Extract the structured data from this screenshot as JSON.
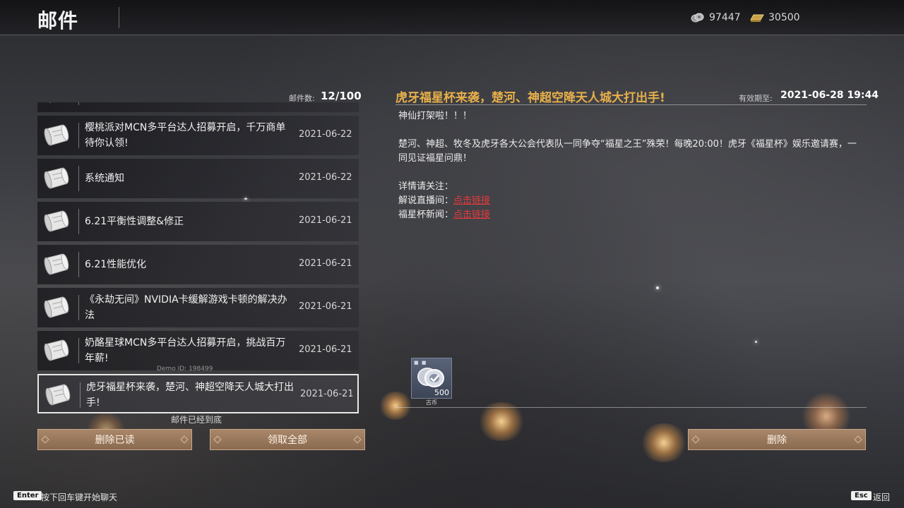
{
  "header": {
    "title": "邮件",
    "currency": [
      {
        "icon": "silver-coin-icon",
        "value": "97447"
      },
      {
        "icon": "gold-ingot-icon",
        "value": "30500"
      }
    ]
  },
  "mail_list": {
    "count_label": "邮件数:",
    "count_value": "12/100",
    "items": [
      {
        "title": "赛  寺日豆场",
        "date": ""
      },
      {
        "title": "樱桃派对MCN多平台达人招募开启，千万商单待你认领!",
        "date": "2021-06-22"
      },
      {
        "title": "系统通知",
        "date": "2021-06-22"
      },
      {
        "title": "6.21平衡性调整&修正",
        "date": "2021-06-21"
      },
      {
        "title": "6.21性能优化",
        "date": "2021-06-21"
      },
      {
        "title": "《永劫无间》NVIDIA卡缓解游戏卡顿的解决办法",
        "date": "2021-06-21"
      },
      {
        "title": "奶酪星球MCN多平台达人招募开启，挑战百万年薪!",
        "date": "2021-06-21"
      },
      {
        "title": "虎牙福星杯来袭，楚河、神超空降天人城大打出手!",
        "date": "2021-06-21"
      }
    ],
    "end_text": "邮件已经到底",
    "watermark": "Demo   ID: 198499"
  },
  "buttons": {
    "delete_read": "删除已读",
    "claim_all": "领取全部",
    "delete": "删除"
  },
  "detail": {
    "title": "虎牙福星杯来袭，楚河、神超空降天人城大打出手!",
    "expire_label": "有效期至:",
    "expire_value": "2021-06-28 19:44",
    "line1": "神仙打架啦！！！",
    "line2": "楚河、神超、牧冬及虎牙各大公会代表队一同争夺“福星之王”殊荣！每晚20:00！虎牙《福星杯》娱乐邀请赛，一同见证福星问鼎！",
    "line3": "详情请关注：",
    "line4_label": "解说直播间：",
    "line5_label": "福星杯新闻：",
    "link_text": "点击链接",
    "attachment": {
      "qty": "500",
      "label": "古币",
      "dots": "■ ■",
      "icon": "coin-pile-icon"
    }
  },
  "footer": {
    "enter_key": "Enter",
    "enter_hint": "按下回车键开始聊天",
    "esc_key": "Esc",
    "esc_hint": "返回"
  },
  "colors": {
    "accent_title": "#e8b04a",
    "link": "#e23a3a",
    "button": "#8a6a50"
  }
}
